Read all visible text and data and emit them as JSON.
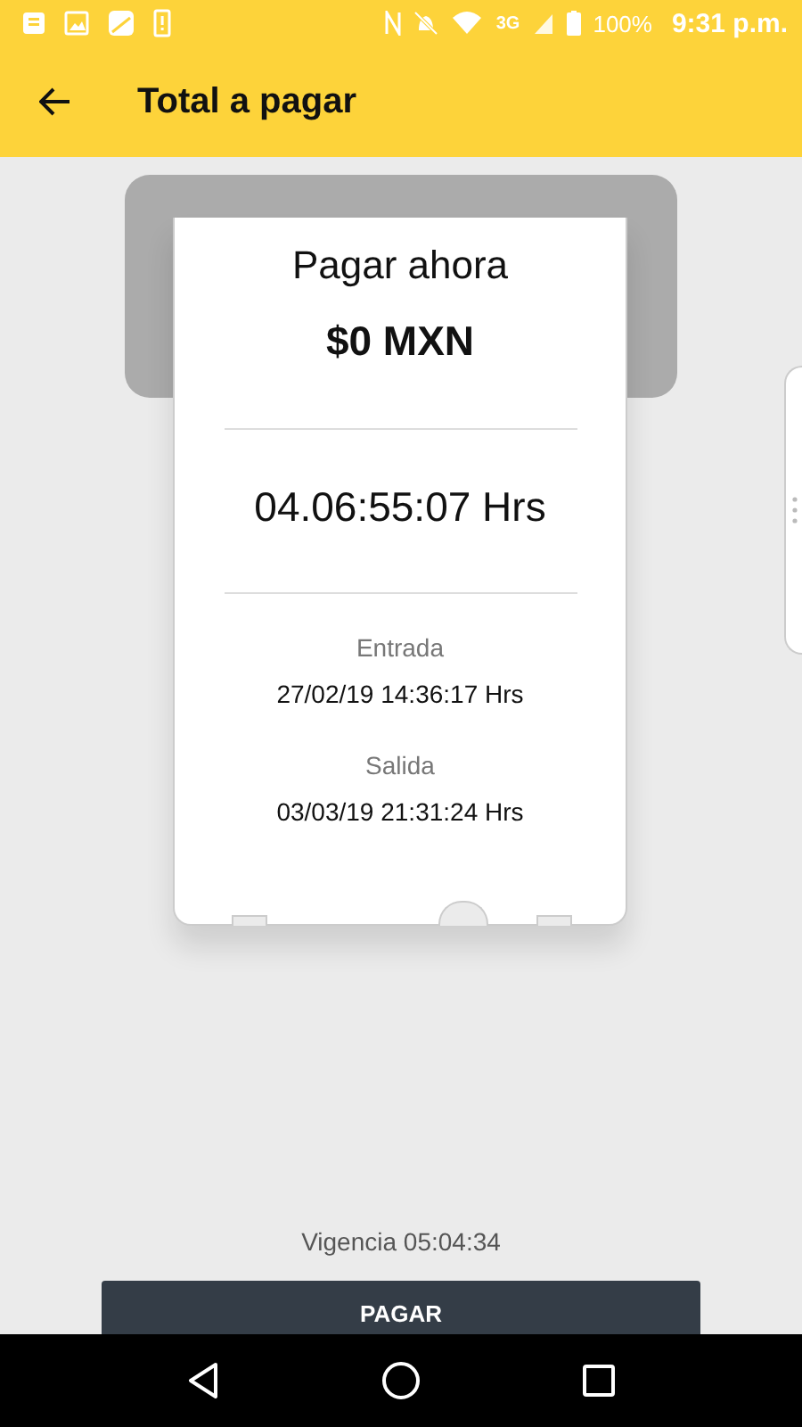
{
  "status_bar": {
    "network": "3G",
    "battery": "100%",
    "time": "9:31 p.m."
  },
  "app_bar": {
    "title": "Total a pagar"
  },
  "ticket": {
    "heading": "Pagar ahora",
    "amount": "$0 MXN",
    "duration": "04.06:55:07 Hrs",
    "entries": [
      {
        "label": "Entrada",
        "value": "27/02/19 14:36:17 Hrs"
      },
      {
        "label": "Salida",
        "value": "03/03/19 21:31:24 Hrs"
      }
    ]
  },
  "validity": "Vigencia 05:04:34",
  "pay_button": {
    "label": "PAGAR"
  }
}
